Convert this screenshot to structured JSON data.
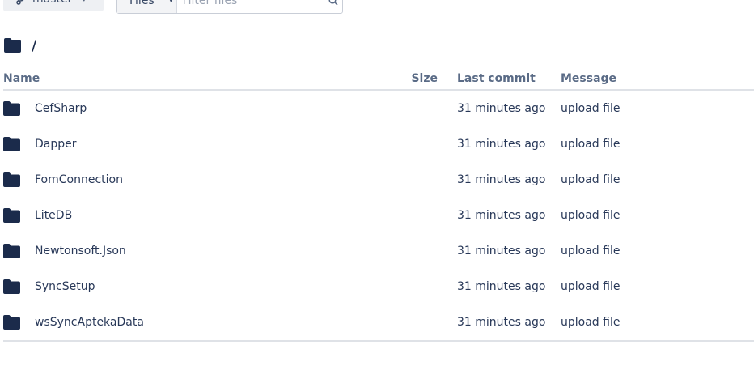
{
  "toolbar": {
    "branch": "master",
    "filter_type": "Files",
    "filter_placeholder": "Filter files"
  },
  "path": "/",
  "table": {
    "headers": {
      "name": "Name",
      "size": "Size",
      "last_commit": "Last commit",
      "message": "Message"
    },
    "rows": [
      {
        "name": "CefSharp",
        "size": "",
        "last_commit": "31 minutes ago",
        "message": "upload file"
      },
      {
        "name": "Dapper",
        "size": "",
        "last_commit": "31 minutes ago",
        "message": "upload file"
      },
      {
        "name": "FomConnection",
        "size": "",
        "last_commit": "31 minutes ago",
        "message": "upload file"
      },
      {
        "name": "LiteDB",
        "size": "",
        "last_commit": "31 minutes ago",
        "message": "upload file"
      },
      {
        "name": "Newtonsoft.Json",
        "size": "",
        "last_commit": "31 minutes ago",
        "message": "upload file"
      },
      {
        "name": "SyncSetup",
        "size": "",
        "last_commit": "31 minutes ago",
        "message": "upload file"
      },
      {
        "name": "wsSyncAptekaData",
        "size": "",
        "last_commit": "31 minutes ago",
        "message": "upload file"
      }
    ]
  },
  "colors": {
    "folder": "#1b2b4b",
    "text": "#283858",
    "header_text": "#5a6b86",
    "divider": "#dfe2e7"
  }
}
